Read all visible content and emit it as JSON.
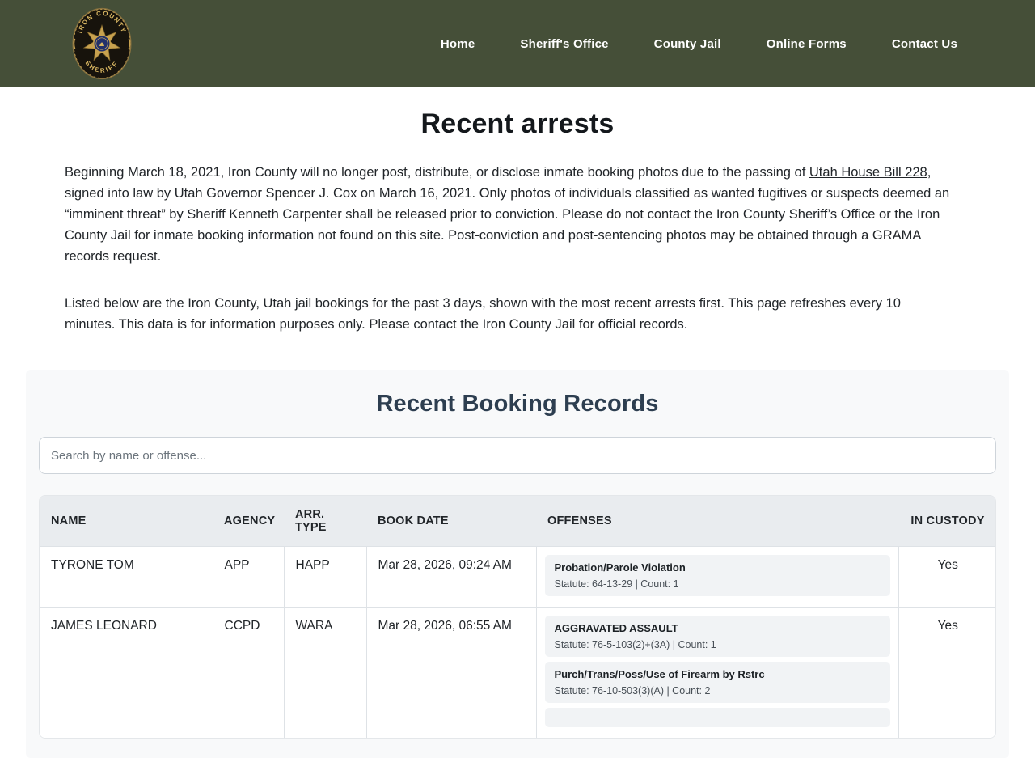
{
  "colors": {
    "header-bg": "#454f38",
    "panel-bg": "#f8f9fa",
    "thead-bg": "#e9ecef",
    "pill-bg": "#f1f3f5",
    "heading2": "#2d3e50"
  },
  "header": {
    "logo": {
      "top_text": "IRON COUNTY",
      "bottom_text": "SHERIFF"
    },
    "nav": [
      {
        "label": "Home"
      },
      {
        "label": "Sheriff's Office"
      },
      {
        "label": "County Jail"
      },
      {
        "label": "Online Forms"
      },
      {
        "label": "Contact Us"
      }
    ]
  },
  "page": {
    "title": "Recent arrests",
    "intro": {
      "before_link": "Beginning March 18, 2021, Iron County will no longer post, distribute, or disclose inmate booking photos due to the passing of ",
      "link_text": "Utah House Bill 228",
      "after_link": ", signed into law by Utah Governor Spencer J. Cox on March 16, 2021. Only photos of individuals classified as wanted fugitives or suspects deemed an “imminent threat” by Sheriff Kenneth Carpenter shall be released prior to conviction. Please do not contact the Iron County Sheriff’s Office or the Iron County Jail for inmate booking information not found on this site. Post-conviction and post-sentencing photos may be obtained through a GRAMA records request."
    },
    "listing_note": "Listed below are the Iron County, Utah jail bookings for the past 3 days, shown with the most recent arrests first. This page refreshes every 10 minutes. This data is for information purposes only. Please contact the Iron County Jail for official records."
  },
  "records": {
    "heading": "Recent Booking Records",
    "search_placeholder": "Search by name or offense...",
    "columns": [
      "NAME",
      "AGENCY",
      "ARR. TYPE",
      "BOOK DATE",
      "OFFENSES",
      "IN CUSTODY"
    ],
    "rows": [
      {
        "name": "TYRONE TOM",
        "agency": "APP",
        "arr_type": "HAPP",
        "book_date": "Mar 28, 2026, 09:24 AM",
        "in_custody": "Yes",
        "offenses": [
          {
            "title": "Probation/Parole Violation",
            "statute": "Statute: 64-13-29 | Count: 1"
          }
        ]
      },
      {
        "name": "JAMES LEONARD",
        "agency": "CCPD",
        "arr_type": "WARA",
        "book_date": "Mar 28, 2026, 06:55 AM",
        "in_custody": "Yes",
        "offenses": [
          {
            "title": "AGGRAVATED ASSAULT",
            "statute": "Statute: 76-5-103(2)+(3A) | Count: 1"
          },
          {
            "title": "Purch/Trans/Poss/Use of Firearm by Rstrc",
            "statute": "Statute: 76-10-503(3)(A) | Count: 2"
          },
          {
            "title": "",
            "statute": ""
          }
        ]
      }
    ]
  }
}
